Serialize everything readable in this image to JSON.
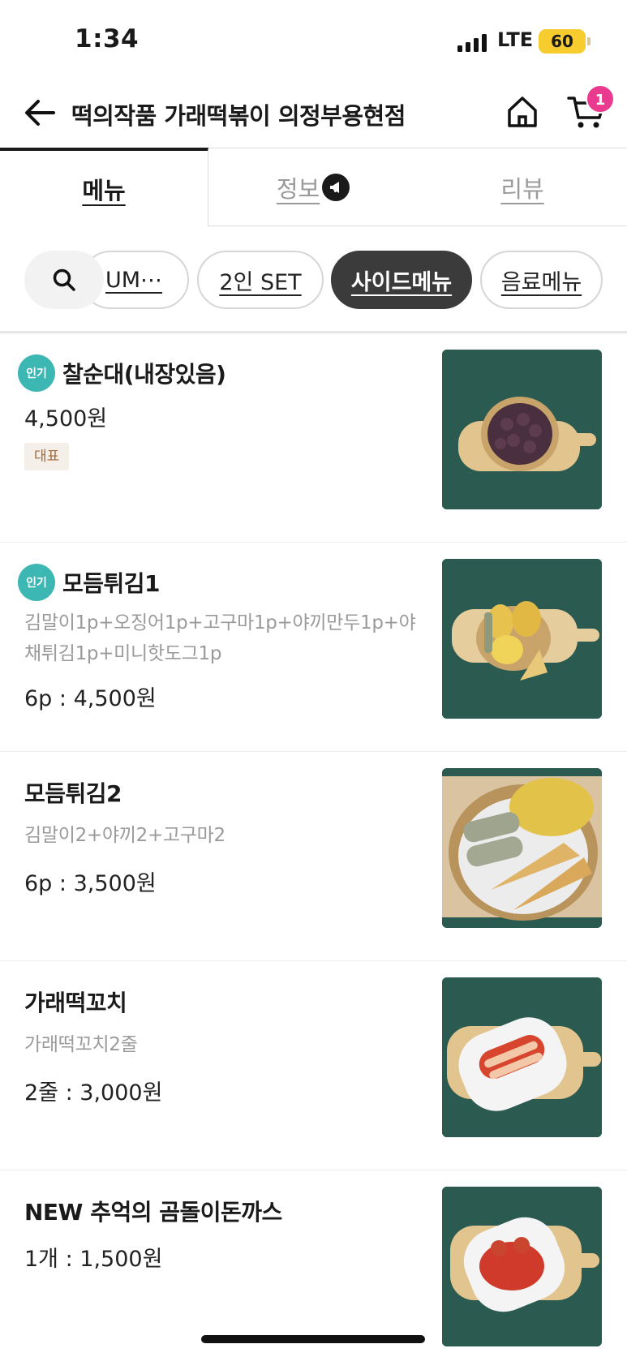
{
  "status_bar": {
    "time": "1:34",
    "network": "LTE",
    "battery": "60"
  },
  "header": {
    "title": "떡의작품 가래떡볶이 의정부용현점",
    "cart_count": "1"
  },
  "tabs": [
    {
      "label": "메뉴",
      "active": true
    },
    {
      "label": "정보",
      "active": false
    },
    {
      "label": "리뷰",
      "active": false
    }
  ],
  "categories": [
    {
      "label": "UM⋯"
    },
    {
      "label": "2인 SET"
    },
    {
      "label": "사이드메뉴",
      "active": true
    },
    {
      "label": "음료메뉴"
    }
  ],
  "menu_items": [
    {
      "name": "찰순대(내장있음)",
      "popular_badge": "인기",
      "description": "",
      "price": "4,500원",
      "tag": "대표"
    },
    {
      "name": "모듬튀김1",
      "popular_badge": "인기",
      "description": "김말이1p+오징어1p+고구마1p+야끼만두1p+야채튀김1p+미니핫도그1p",
      "price": "6p : 4,500원"
    },
    {
      "name": "모듬튀김2",
      "description": "김말이2+야끼2+고구마2",
      "price": "6p : 3,500원"
    },
    {
      "name": "가래떡꼬치",
      "description": "가래떡꼬치2줄",
      "price": "2줄 : 3,000원"
    },
    {
      "name": "NEW 추억의 곰돌이돈까스",
      "description": "",
      "price": "1개 : 1,500원"
    }
  ],
  "colors": {
    "popular_badge": "#3db7b3",
    "cart_badge": "#e93a8f",
    "active_chip": "#3b3b3b",
    "battery": "#f6cc2f",
    "image_bg": "#26574d"
  }
}
